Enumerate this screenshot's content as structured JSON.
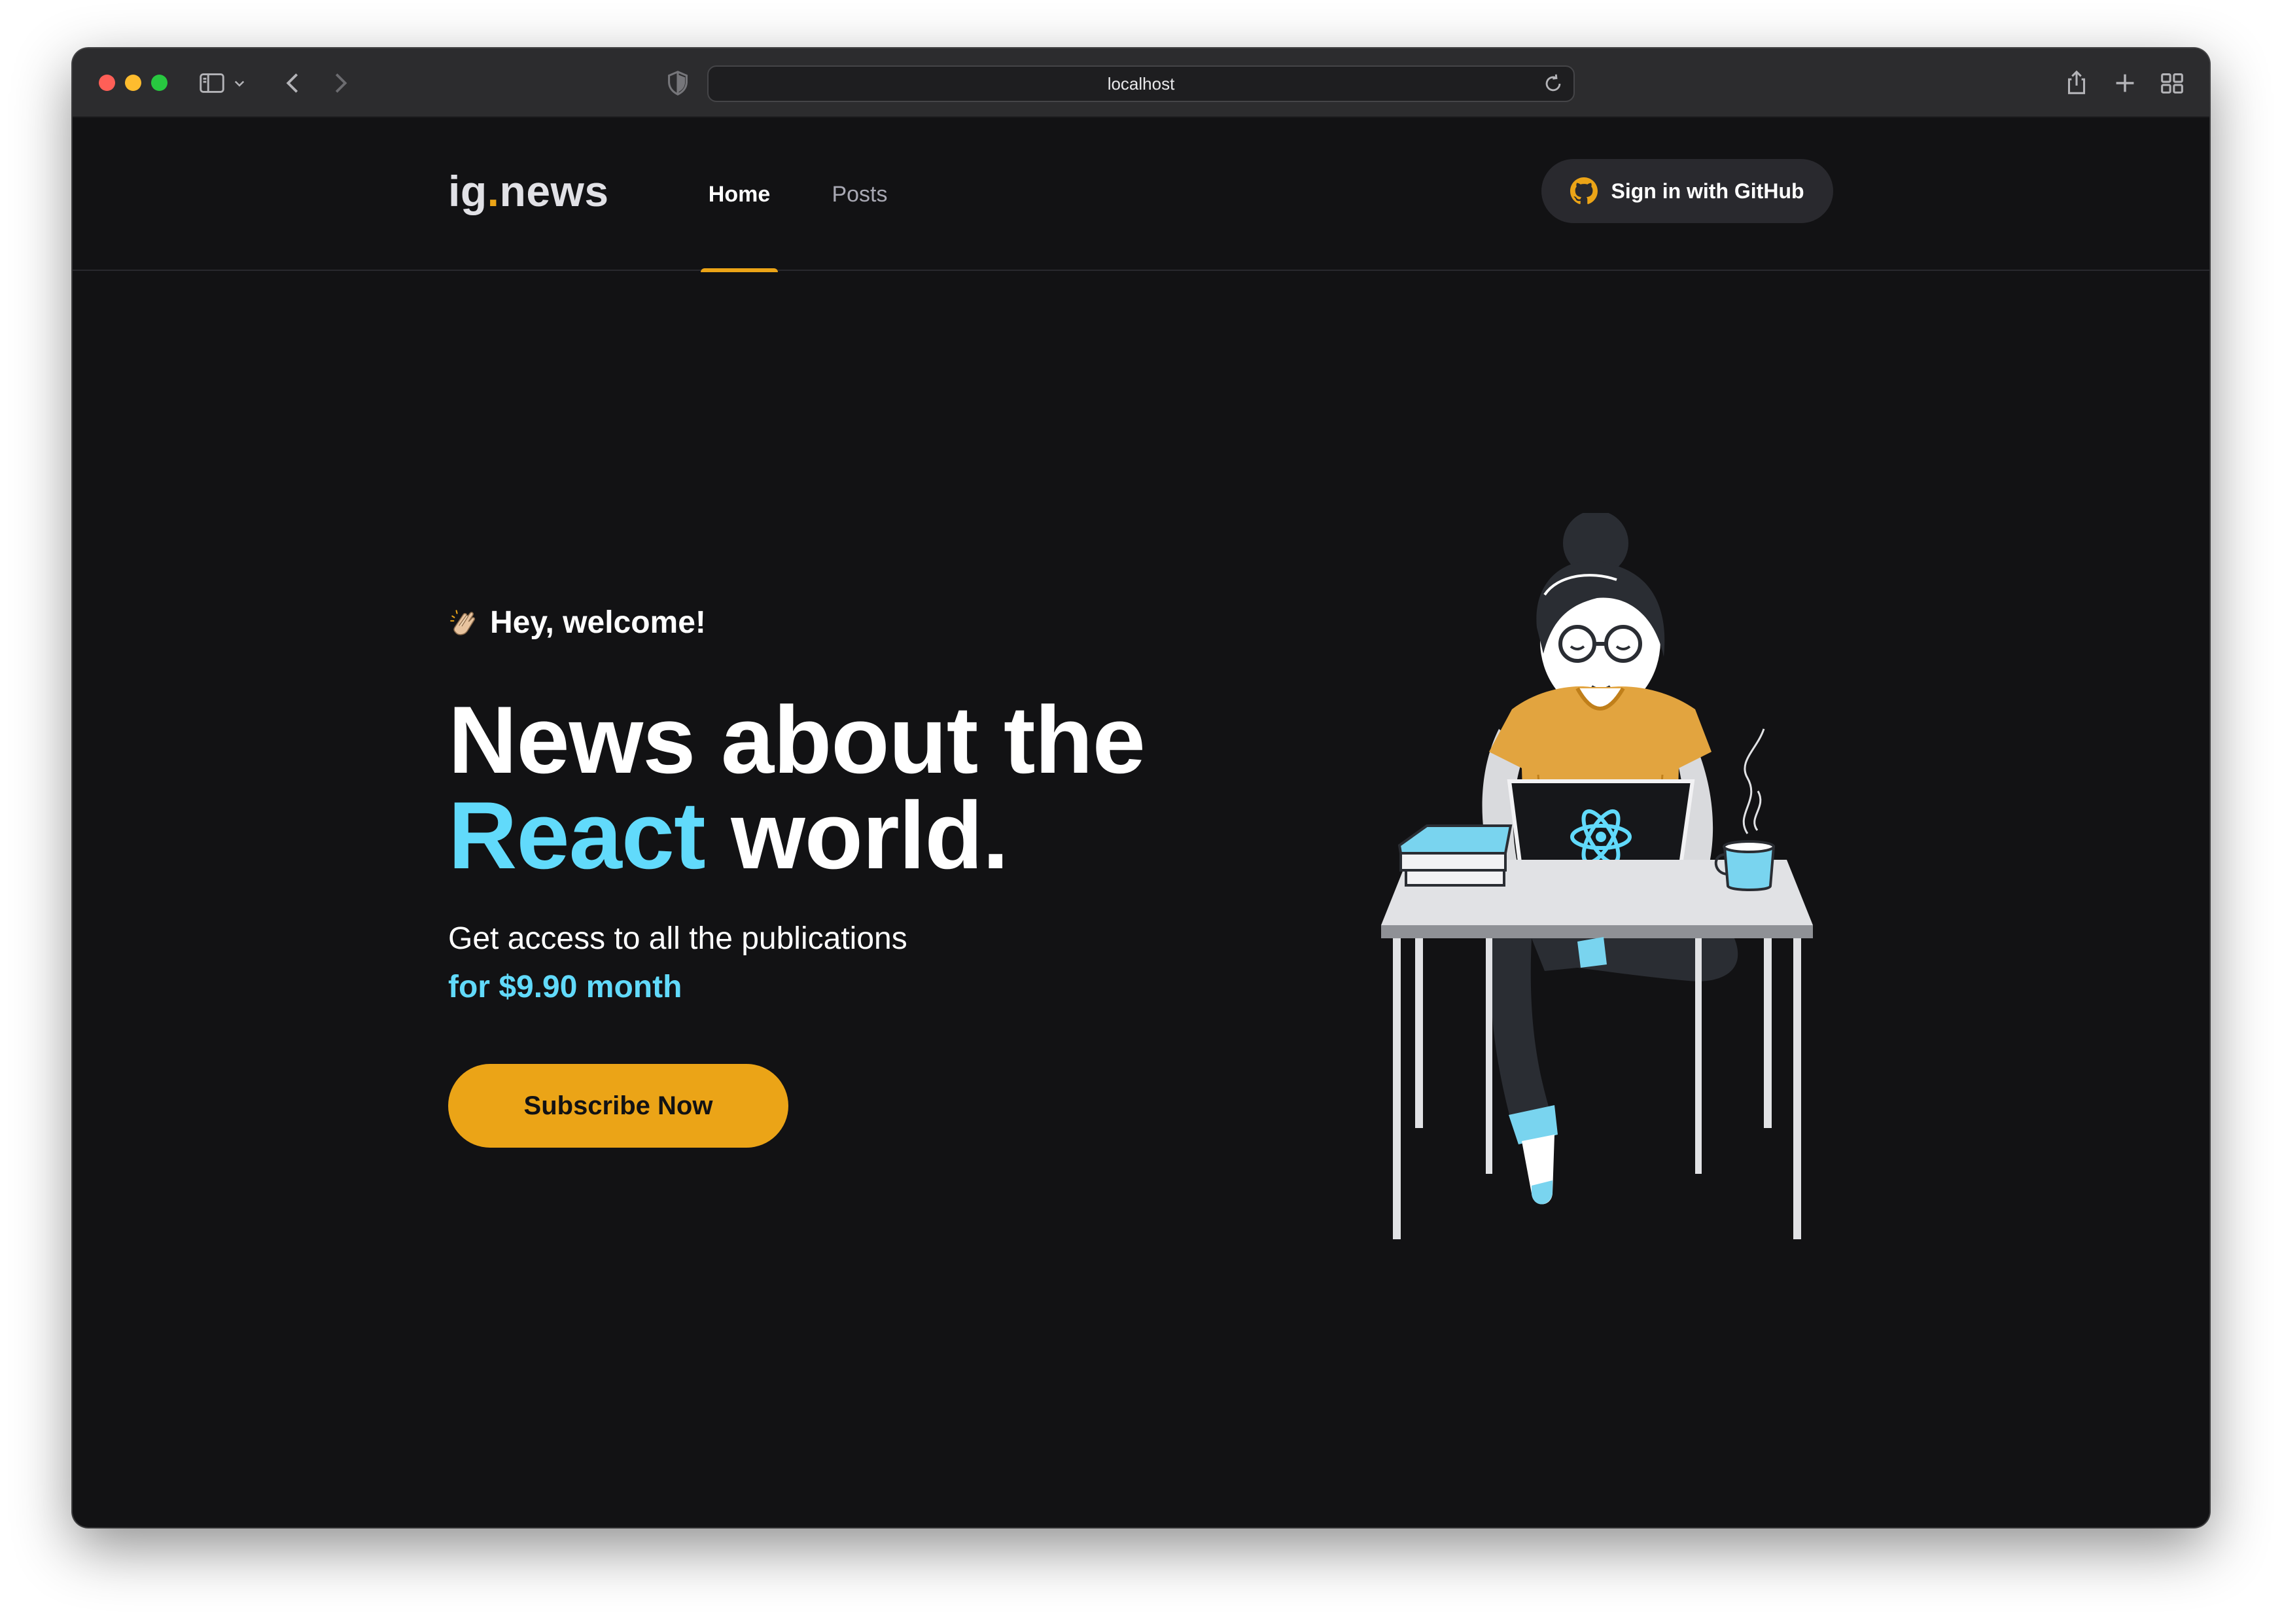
{
  "browser": {
    "url": "localhost"
  },
  "site": {
    "logo_main": "ig",
    "logo_dot": ".",
    "logo_rest": "news",
    "nav": [
      {
        "label": "Home",
        "active": true
      },
      {
        "label": "Posts",
        "active": false
      }
    ],
    "signin_label": "Sign in with GitHub"
  },
  "hero": {
    "welcome": "Hey, welcome!",
    "headline_line1": "News about the",
    "headline_accent": "React",
    "headline_rest": " world.",
    "subtitle": "Get access to all the publications",
    "price": "for $9.90 month",
    "cta_label": "Subscribe Now"
  },
  "colors": {
    "background": "#121214",
    "accent_yellow": "#eba417",
    "accent_cyan": "#61dafb"
  },
  "icons": {
    "github": "github-icon",
    "clap": "clapping-hands-icon"
  }
}
